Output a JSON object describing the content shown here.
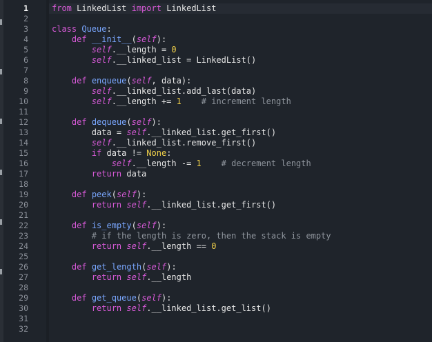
{
  "editor": {
    "active_line": 1,
    "line_numbers": [
      "1",
      "2",
      "3",
      "4",
      "5",
      "6",
      "7",
      "8",
      "9",
      "10",
      "11",
      "12",
      "13",
      "14",
      "15",
      "16",
      "17",
      "18",
      "19",
      "20",
      "21",
      "22",
      "23",
      "24",
      "25",
      "26",
      "27",
      "28",
      "29",
      "30",
      "31",
      "32"
    ],
    "lines": [
      [
        [
          "kw",
          "from"
        ],
        [
          "txt",
          " LinkedList "
        ],
        [
          "kw",
          "import"
        ],
        [
          "txt",
          " LinkedList"
        ]
      ],
      [],
      [
        [
          "kw",
          "class"
        ],
        [
          "txt",
          " "
        ],
        [
          "fn",
          "Queue"
        ],
        [
          "txt",
          ":"
        ]
      ],
      [
        [
          "txt",
          "    "
        ],
        [
          "kw",
          "def"
        ],
        [
          "txt",
          " "
        ],
        [
          "fn",
          "__init__"
        ],
        [
          "txt",
          "("
        ],
        [
          "self",
          "self"
        ],
        [
          "txt",
          "):"
        ]
      ],
      [
        [
          "txt",
          "        "
        ],
        [
          "self",
          "self"
        ],
        [
          "txt",
          ".__length = "
        ],
        [
          "num",
          "0"
        ]
      ],
      [
        [
          "txt",
          "        "
        ],
        [
          "self",
          "self"
        ],
        [
          "txt",
          ".__linked_list = LinkedList()"
        ]
      ],
      [],
      [
        [
          "txt",
          "    "
        ],
        [
          "kw",
          "def"
        ],
        [
          "txt",
          " "
        ],
        [
          "fn",
          "enqueue"
        ],
        [
          "txt",
          "("
        ],
        [
          "self",
          "self"
        ],
        [
          "txt",
          ", data):"
        ]
      ],
      [
        [
          "txt",
          "        "
        ],
        [
          "self",
          "self"
        ],
        [
          "txt",
          ".__linked_list.add_last(data)"
        ]
      ],
      [
        [
          "txt",
          "        "
        ],
        [
          "self",
          "self"
        ],
        [
          "txt",
          ".__length += "
        ],
        [
          "num",
          "1"
        ],
        [
          "txt",
          "    "
        ],
        [
          "com",
          "# increment length"
        ]
      ],
      [],
      [
        [
          "txt",
          "    "
        ],
        [
          "kw",
          "def"
        ],
        [
          "txt",
          " "
        ],
        [
          "fn",
          "dequeue"
        ],
        [
          "txt",
          "("
        ],
        [
          "self",
          "self"
        ],
        [
          "txt",
          "):"
        ]
      ],
      [
        [
          "txt",
          "        data = "
        ],
        [
          "self",
          "self"
        ],
        [
          "txt",
          ".__linked_list.get_first()"
        ]
      ],
      [
        [
          "txt",
          "        "
        ],
        [
          "self",
          "self"
        ],
        [
          "txt",
          ".__linked_list.remove_first()"
        ]
      ],
      [
        [
          "txt",
          "        "
        ],
        [
          "kw",
          "if"
        ],
        [
          "txt",
          " data != "
        ],
        [
          "num",
          "None"
        ],
        [
          "txt",
          ":"
        ]
      ],
      [
        [
          "txt",
          "            "
        ],
        [
          "self",
          "self"
        ],
        [
          "txt",
          ".__length -= "
        ],
        [
          "num",
          "1"
        ],
        [
          "txt",
          "    "
        ],
        [
          "com",
          "# decrement length"
        ]
      ],
      [
        [
          "txt",
          "        "
        ],
        [
          "kw",
          "return"
        ],
        [
          "txt",
          " data"
        ]
      ],
      [],
      [
        [
          "txt",
          "    "
        ],
        [
          "kw",
          "def"
        ],
        [
          "txt",
          " "
        ],
        [
          "fn",
          "peek"
        ],
        [
          "txt",
          "("
        ],
        [
          "self",
          "self"
        ],
        [
          "txt",
          "):"
        ]
      ],
      [
        [
          "txt",
          "        "
        ],
        [
          "kw",
          "return"
        ],
        [
          "txt",
          " "
        ],
        [
          "self",
          "self"
        ],
        [
          "txt",
          ".__linked_list.get_first()"
        ]
      ],
      [],
      [
        [
          "txt",
          "    "
        ],
        [
          "kw",
          "def"
        ],
        [
          "txt",
          " "
        ],
        [
          "fn",
          "is_empty"
        ],
        [
          "txt",
          "("
        ],
        [
          "self",
          "self"
        ],
        [
          "txt",
          "):"
        ]
      ],
      [
        [
          "txt",
          "        "
        ],
        [
          "com",
          "# if the length is zero, then the stack is empty"
        ]
      ],
      [
        [
          "txt",
          "        "
        ],
        [
          "kw",
          "return"
        ],
        [
          "txt",
          " "
        ],
        [
          "self",
          "self"
        ],
        [
          "txt",
          ".__length == "
        ],
        [
          "num",
          "0"
        ]
      ],
      [],
      [
        [
          "txt",
          "    "
        ],
        [
          "kw",
          "def"
        ],
        [
          "txt",
          " "
        ],
        [
          "fn",
          "get_length"
        ],
        [
          "txt",
          "("
        ],
        [
          "self",
          "self"
        ],
        [
          "txt",
          "):"
        ]
      ],
      [
        [
          "txt",
          "        "
        ],
        [
          "kw",
          "return"
        ],
        [
          "txt",
          " "
        ],
        [
          "self",
          "self"
        ],
        [
          "txt",
          ".__length"
        ]
      ],
      [],
      [
        [
          "txt",
          "    "
        ],
        [
          "kw",
          "def"
        ],
        [
          "txt",
          " "
        ],
        [
          "fn",
          "get_queue"
        ],
        [
          "txt",
          "("
        ],
        [
          "self",
          "self"
        ],
        [
          "txt",
          "):"
        ]
      ],
      [
        [
          "txt",
          "        "
        ],
        [
          "kw",
          "return"
        ],
        [
          "txt",
          " "
        ],
        [
          "self",
          "self"
        ],
        [
          "txt",
          ".__linked_list.get_list()"
        ]
      ],
      [],
      []
    ]
  }
}
